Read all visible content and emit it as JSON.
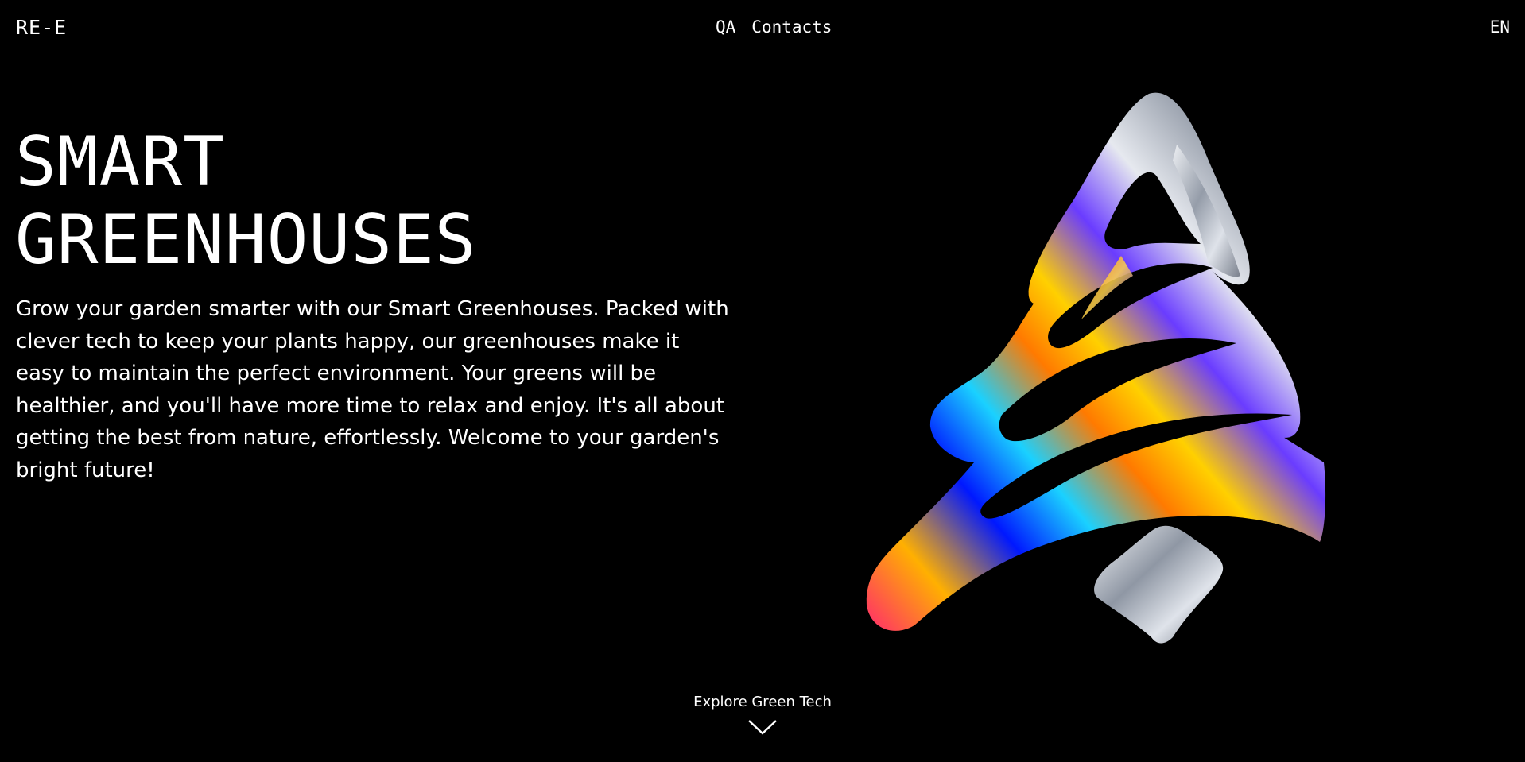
{
  "header": {
    "logo": "RE-E",
    "nav": [
      {
        "label": "QA"
      },
      {
        "label": "Contacts"
      }
    ],
    "language": "EN"
  },
  "hero": {
    "title": "SMART\nGREENHOUSES",
    "description": "Grow your garden smarter with our Smart Greenhouses. Packed with clever tech to keep your plants happy, our greenhouses make it easy to maintain the perfect environment. Your greens will be healthier, and you'll have more time to relax and enjoy. It's all about getting the best from nature, effortlessly. Welcome to your garden's bright future!",
    "art_icon": "iridescent-tree-icon"
  },
  "explore": {
    "label": "Explore Green Tech",
    "icon": "chevron-down-icon"
  },
  "colors": {
    "background": "#000000",
    "text": "#ffffff",
    "accent_orange": "#ff8a00",
    "accent_blue": "#0a2cff",
    "accent_silver": "#c9ced6"
  }
}
